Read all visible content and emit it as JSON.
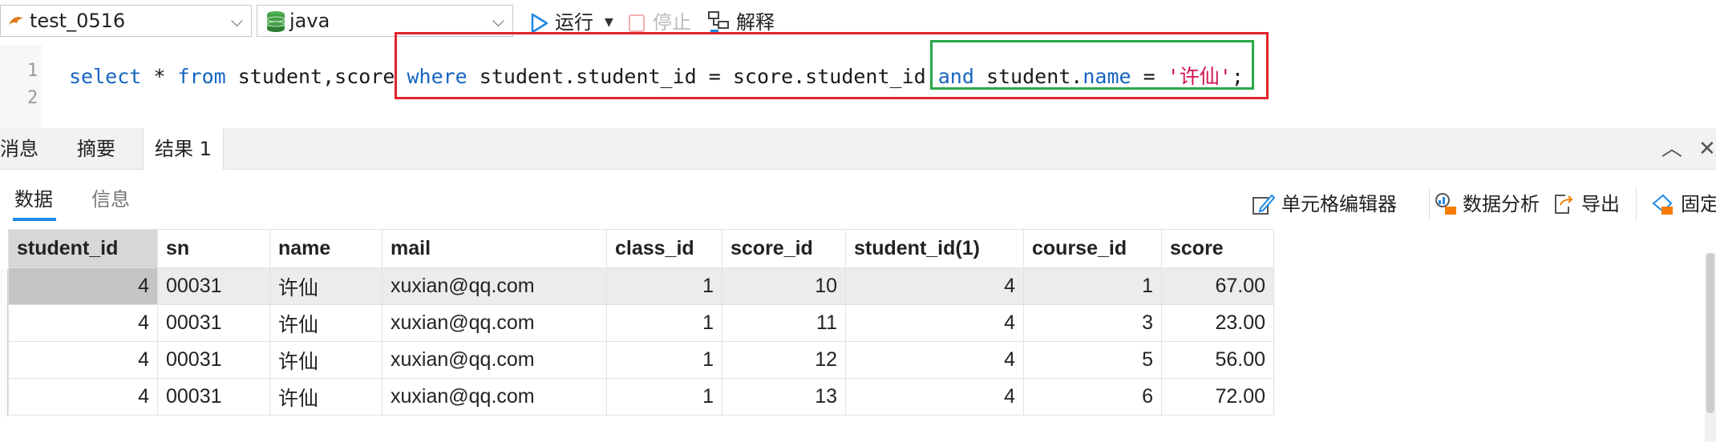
{
  "toolbar": {
    "connection": "test_0516",
    "schema": "java",
    "run_label": "运行",
    "stop_label": "停止",
    "explain_label": "解释"
  },
  "editor": {
    "line_numbers": [
      "1",
      "2"
    ],
    "sql": {
      "t1": "select",
      "t2": " * ",
      "t3": "from",
      "t4": " student,score ",
      "t5": "where",
      "t6": " student.student_id = score.student_id ",
      "t7": "and",
      "t8": " student.",
      "t9": "name",
      "t10": " = ",
      "t11": "'许仙'",
      "t12": ";"
    },
    "highlight_colors": {
      "red_box": "#e0242b",
      "green_box": "#2aa74a"
    }
  },
  "result_tabs": [
    "消息",
    "摘要",
    "结果 1"
  ],
  "sub_tabs": [
    "数据",
    "信息"
  ],
  "actions": {
    "cell_editor": "单元格编辑器",
    "data_analysis": "数据分析",
    "export": "导出",
    "pin": "固定"
  },
  "grid": {
    "columns": [
      "student_id",
      "sn",
      "name",
      "mail",
      "class_id",
      "score_id",
      "student_id(1)",
      "course_id",
      "score"
    ],
    "rows": [
      [
        "4",
        "00031",
        "许仙",
        "xuxian@qq.com",
        "1",
        "10",
        "4",
        "1",
        "67.00"
      ],
      [
        "4",
        "00031",
        "许仙",
        "xuxian@qq.com",
        "1",
        "11",
        "4",
        "3",
        "23.00"
      ],
      [
        "4",
        "00031",
        "许仙",
        "xuxian@qq.com",
        "1",
        "12",
        "4",
        "5",
        "56.00"
      ],
      [
        "4",
        "00031",
        "许仙",
        "xuxian@qq.com",
        "1",
        "13",
        "4",
        "6",
        "72.00"
      ]
    ]
  }
}
